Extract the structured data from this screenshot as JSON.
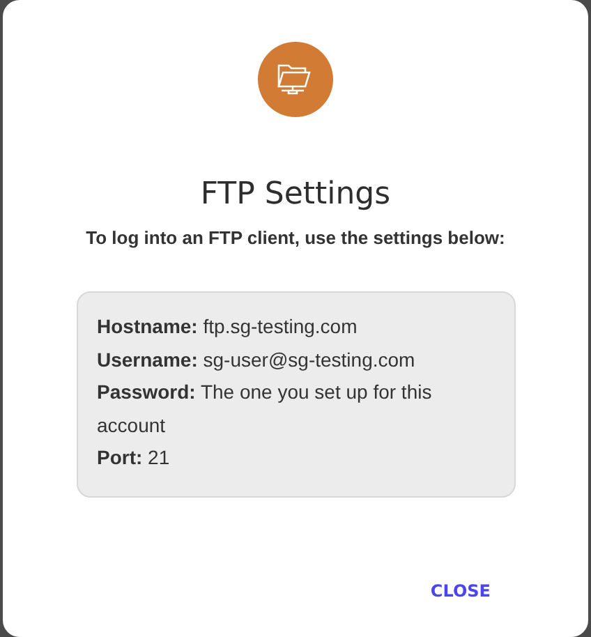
{
  "dialog": {
    "title": "FTP Settings",
    "subtitle": "To log into an FTP client, use the settings below:",
    "details": [
      "**Hostname:** ftp.sg-testing.com",
      "**Username:** sg-user@sg-testing.com",
      "**Password:** The one you set up for this account",
      "**Port:** 21"
    ],
    "buttons": [
      "CLOSE"
    ]
  }
}
